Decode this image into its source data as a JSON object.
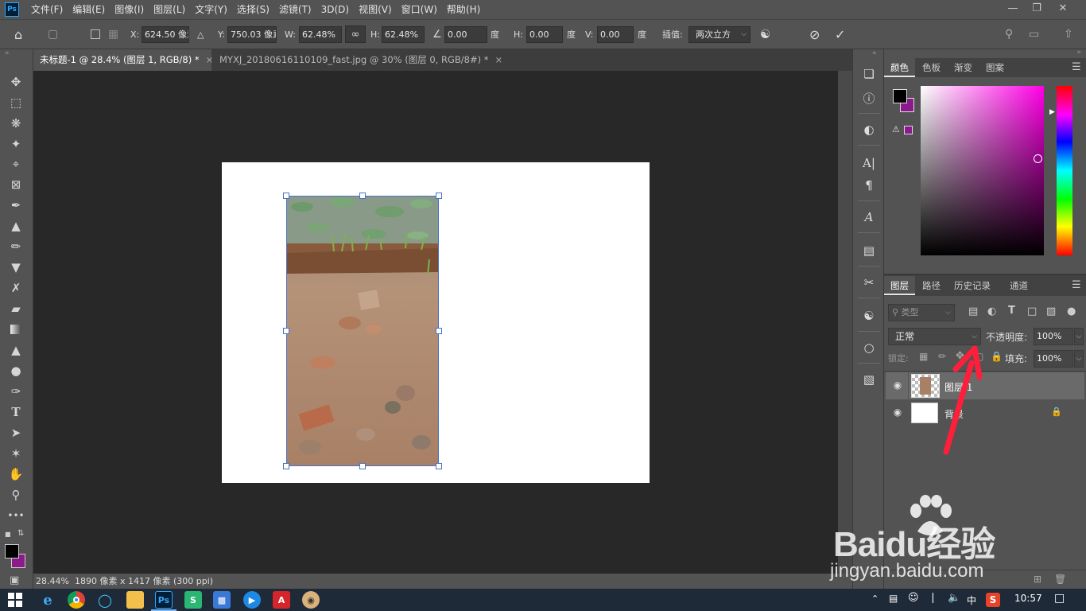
{
  "app": {
    "logo": "Ps"
  },
  "menu": [
    "文件(F)",
    "编辑(E)",
    "图像(I)",
    "图层(L)",
    "文字(Y)",
    "选择(S)",
    "滤镜(T)",
    "3D(D)",
    "视图(V)",
    "窗口(W)",
    "帮助(H)"
  ],
  "window_buttons": [
    "minimize-icon",
    "restore-icon",
    "close-icon"
  ],
  "options": {
    "x_label": "X:",
    "x_value": "624.50 像素",
    "y_label": "Y:",
    "y_value": "750.03 像素",
    "w_label": "W:",
    "w_value": "62.48%",
    "h_label": "H:",
    "h_value": "62.48%",
    "angle_value": "0.00",
    "angle_unit": "度",
    "hskew_label": "H:",
    "hskew_value": "0.00",
    "hskew_unit": "度",
    "vskew_label": "V:",
    "vskew_value": "0.00",
    "vskew_unit": "度",
    "interp_label": "插值:",
    "interp_value": "两次立方"
  },
  "tabs": [
    {
      "label": "未标题-1 @ 28.4% (图层 1, RGB/8) *",
      "active": true
    },
    {
      "label": "MYXJ_20180616110109_fast.jpg @ 30% (图层 0, RGB/8#) *",
      "active": false
    }
  ],
  "status": {
    "zoom": "28.44%",
    "doc_info": "1890 像素 x 1417 像素 (300 ppi)"
  },
  "color_panel": {
    "tabs": [
      "颜色",
      "色板",
      "渐变",
      "图案"
    ],
    "foreground": "#000000",
    "background": "#8b1a8b",
    "hue_color": "#ff00e6"
  },
  "layers_panel": {
    "tabs": [
      "图层",
      "路径",
      "历史记录",
      "通道"
    ],
    "filter_placeholder": "类型",
    "blend_mode": "正常",
    "opacity_label": "不透明度:",
    "opacity_value": "100%",
    "lock_label": "锁定:",
    "fill_label": "填充:",
    "fill_value": "100%",
    "layers": [
      {
        "name": "图层 1",
        "selected": true
      },
      {
        "name": "背景",
        "selected": false
      }
    ]
  },
  "taskbar": {
    "time": "10:57",
    "ime": "中"
  },
  "watermark": {
    "brand": "Baidu经验",
    "url": "jingyan.baidu.com"
  }
}
